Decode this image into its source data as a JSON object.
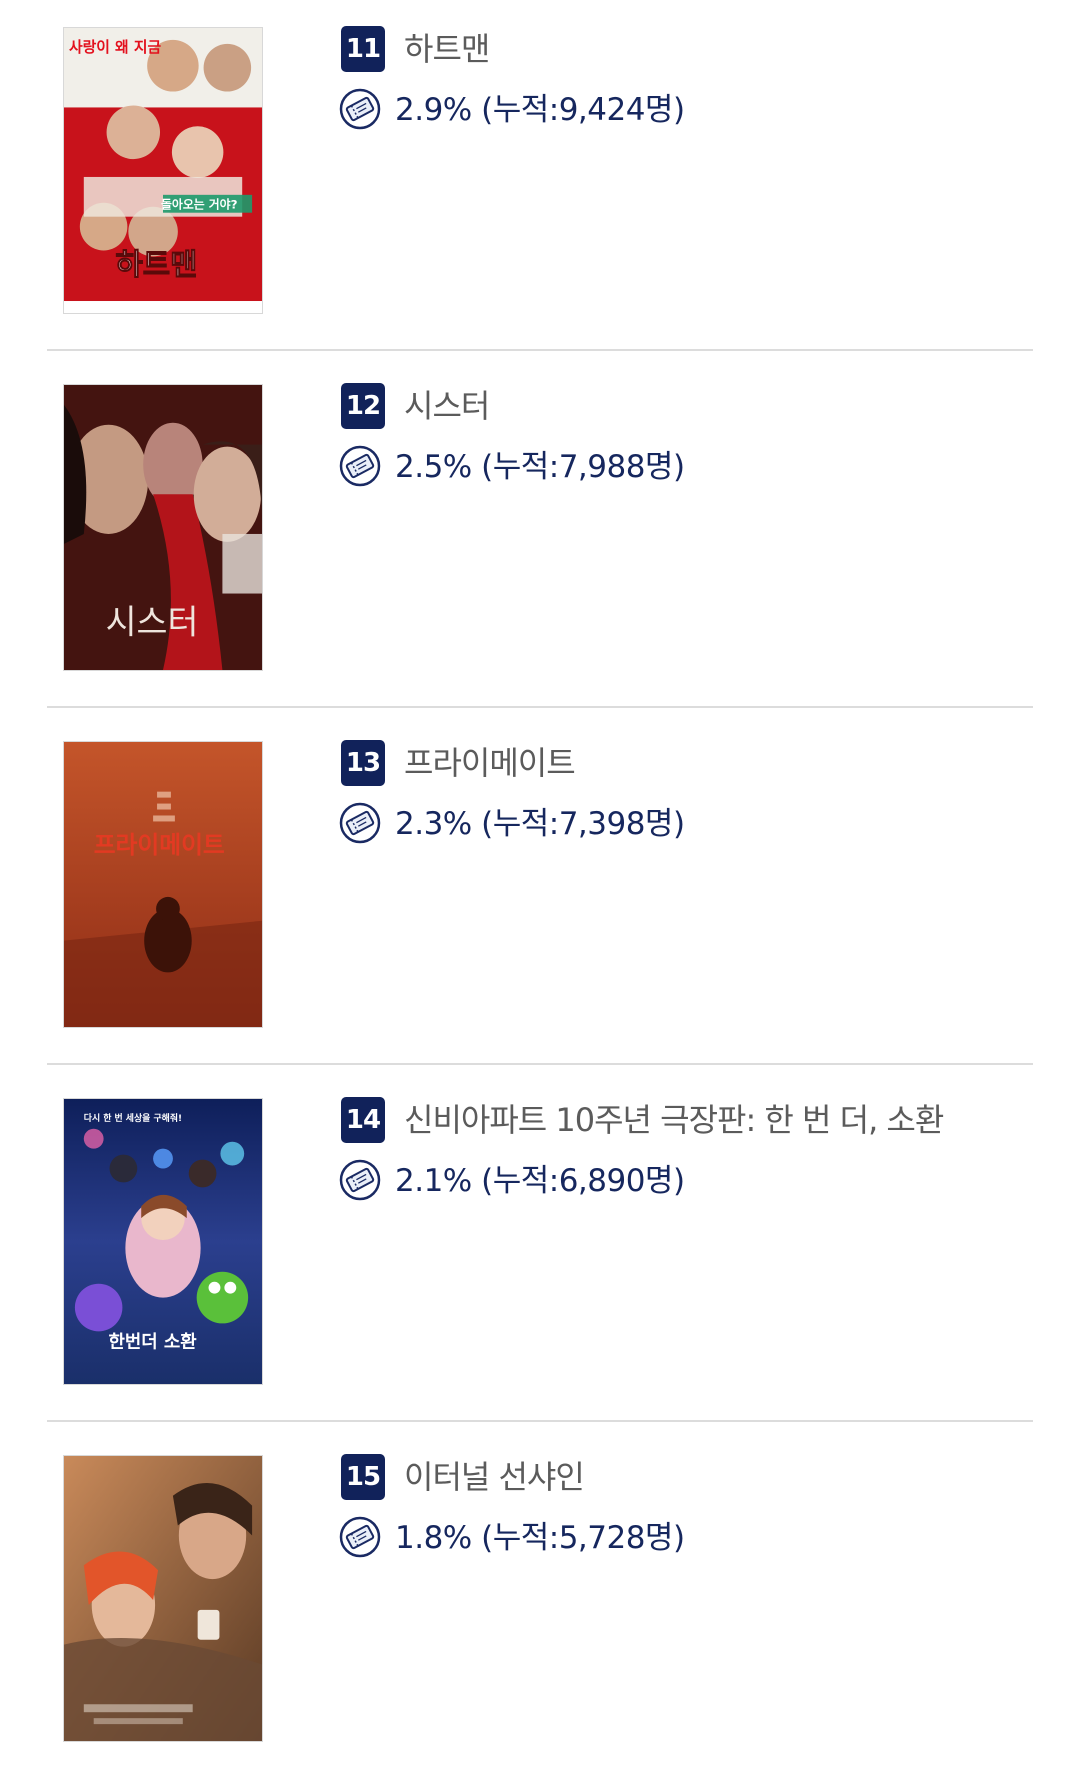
{
  "colors": {
    "rank_badge": "#11225a",
    "title_text": "#5b5b5b",
    "stat_text": "#16275e",
    "divider": "#dcdcdc"
  },
  "items": [
    {
      "rank": "11",
      "title": "하트맨",
      "stat": "2.9% (누적:9,424명)",
      "poster_title": "하트맨",
      "poster_tagline_top": "사랑이 왜 지금",
      "poster_tagline_mid": "돌아오는 거야?",
      "icon": "ticket-icon"
    },
    {
      "rank": "12",
      "title": "시스터",
      "stat": "2.5% (누적:7,988명)",
      "poster_title": "시스터",
      "poster_tagline_top": "",
      "poster_tagline_mid": "",
      "icon": "ticket-icon"
    },
    {
      "rank": "13",
      "title": "프라이메이트",
      "stat": "2.3% (누적:7,398명)",
      "poster_title": "프라이메이트",
      "poster_tagline_top": "",
      "poster_tagline_mid": "",
      "icon": "ticket-icon"
    },
    {
      "rank": "14",
      "title": "신비아파트 10주년 극장판: 한 번 더, 소환",
      "stat": "2.1% (누적:6,890명)",
      "poster_title": "한번더 소환",
      "poster_tagline_top": "다시 한 번 세상을 구해줘!",
      "poster_tagline_mid": "",
      "icon": "ticket-icon"
    },
    {
      "rank": "15",
      "title": "이터널 선샤인",
      "stat": "1.8% (누적:5,728명)",
      "poster_title": "",
      "poster_tagline_top": "",
      "poster_tagline_mid": "",
      "icon": "ticket-icon"
    }
  ]
}
